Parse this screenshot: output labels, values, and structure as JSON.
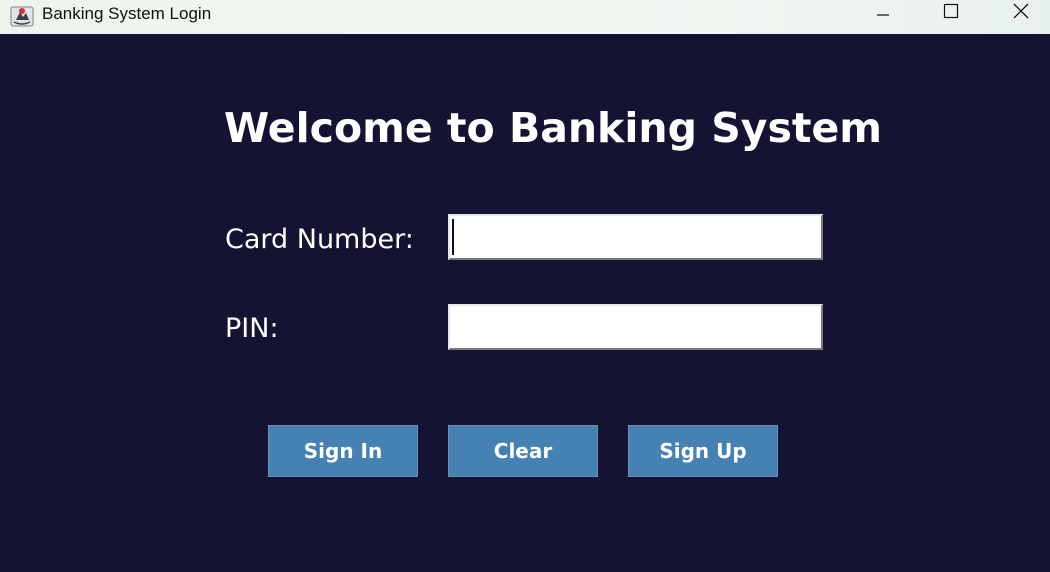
{
  "window": {
    "title": "Banking System Login",
    "icon": "java-app-icon",
    "controls": {
      "minimize": "minimize-icon",
      "maximize": "maximize-icon",
      "close": "close-icon"
    }
  },
  "colors": {
    "background": "#151333",
    "button": "#4681b4",
    "text": "#ffffff"
  },
  "form": {
    "heading": "Welcome to Banking System",
    "card_label": "Card Number:",
    "card_value": "",
    "pin_label": "PIN:",
    "pin_value": ""
  },
  "buttons": {
    "sign_in": "Sign In",
    "clear": "Clear",
    "sign_up": "Sign Up"
  }
}
